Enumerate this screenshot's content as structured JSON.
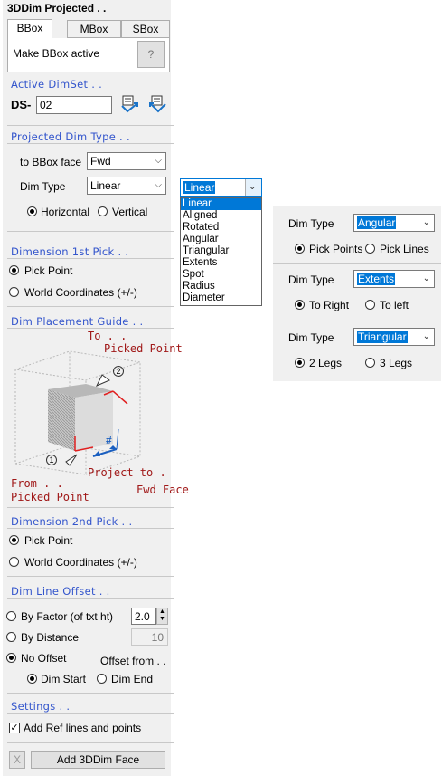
{
  "panel": {
    "title": "3DDim Projected . .",
    "tabs": [
      "BBox",
      "MBox",
      "SBox"
    ],
    "make_active_label": "Make BBox active",
    "help_button": "?"
  },
  "active_dimset": {
    "title": "Active DimSet . .",
    "prefix": "DS-",
    "value": "02"
  },
  "projected_dim_type": {
    "title": "Projected Dim Type . .",
    "bbox_face_label": "to BBox face",
    "bbox_face_value": "Fwd",
    "dim_type_label": "Dim Type",
    "dim_type_value": "Linear",
    "horizontal_label": "Horizontal",
    "vertical_label": "Vertical"
  },
  "dropdown": {
    "selected": "Linear",
    "options": [
      "Linear",
      "Aligned",
      "Rotated",
      "Angular",
      "Triangular",
      "Extents",
      "Spot",
      "Radius",
      "Diameter"
    ]
  },
  "first_pick": {
    "title": "Dimension 1st Pick . .",
    "pick_point": "Pick Point",
    "world_coords": "World Coordinates (+/-)"
  },
  "placement_guide": {
    "title": "Dim Placement Guide . .",
    "to_label": "To . .",
    "picked_point_top": "Picked Point",
    "from_label": "From . .",
    "picked_point_bottom": "Picked Point",
    "project_to": "Project to .",
    "fwd_face": "Fwd Face",
    "marker1": "1",
    "marker2": "2",
    "hash": "#"
  },
  "second_pick": {
    "title": "Dimension 2nd Pick . .",
    "pick_point": "Pick Point",
    "world_coords": "World Coordinates (+/-)"
  },
  "offset": {
    "title": "Dim Line Offset . .",
    "by_factor": "By Factor (of txt ht)",
    "factor_value": "2.0",
    "by_distance": "By Distance",
    "distance_value": "10",
    "no_offset": "No Offset",
    "offset_from": "Offset from . .",
    "dim_start": "Dim Start",
    "dim_end": "Dim End"
  },
  "settings": {
    "title": "Settings . .",
    "add_ref": "Add Ref lines and points",
    "x_button": "X",
    "add_face_button": "Add 3DDim Face"
  },
  "right_panels": [
    {
      "label": "Dim Type",
      "value": "Angular",
      "opt1": "Pick Points",
      "opt2": "Pick Lines"
    },
    {
      "label": "Dim Type",
      "value": "Extents",
      "opt1": "To Right",
      "opt2": "To left"
    },
    {
      "label": "Dim Type",
      "value": "Triangular",
      "opt1": "2 Legs",
      "opt2": "3 Legs"
    }
  ]
}
